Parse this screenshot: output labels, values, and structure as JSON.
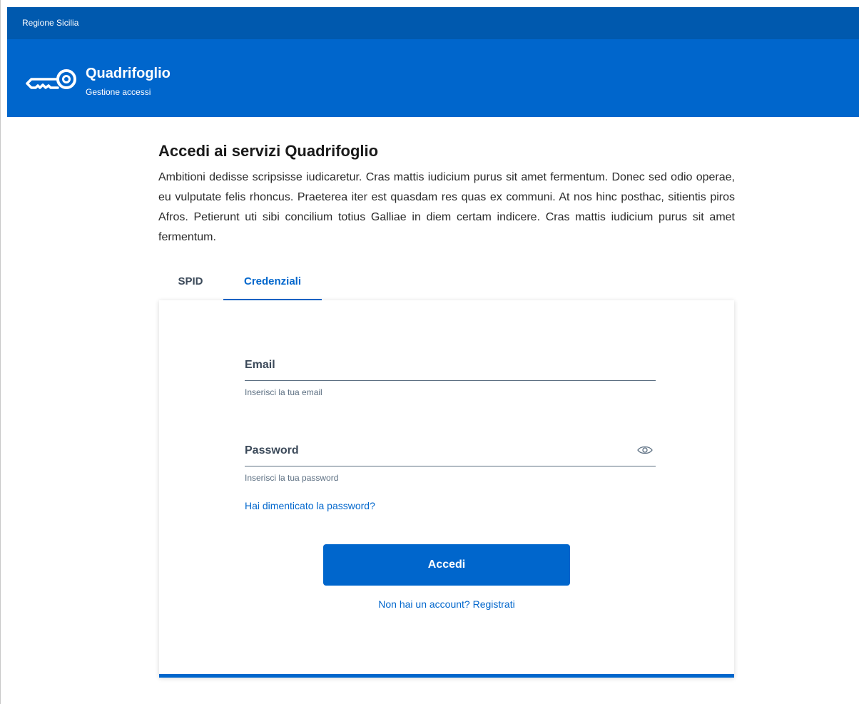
{
  "topbar": {
    "region_label": "Regione Sicilia"
  },
  "header": {
    "icon": "key-icon",
    "title": "Quadrifoglio",
    "subtitle": "Gestione accessi"
  },
  "main": {
    "heading": "Accedi ai servizi Quadrifoglio",
    "intro": "Ambitioni dedisse scripsisse iudicaretur. Cras mattis iudicium purus sit amet fermentum. Donec sed odio operae, eu vulputate felis rhoncus. Praeterea iter est quasdam res quas ex communi. At nos hinc posthac, sitientis piros Afros. Petierunt uti sibi concilium totius Galliae in diem certam indicere. Cras mattis iudicium purus sit amet fermentum."
  },
  "tabs": [
    {
      "label": "SPID",
      "active": false
    },
    {
      "label": "Credenziali",
      "active": true
    }
  ],
  "form": {
    "email": {
      "label": "Email",
      "help": "Inserisci la tua email"
    },
    "password": {
      "label": "Password",
      "help": "Inserisci la tua password",
      "toggle_icon": "eye-icon"
    },
    "forgot_link": "Hai dimenticato la password?",
    "submit_label": "Accedi",
    "register_link": "Non hai un account? Registrati"
  },
  "colors": {
    "topbar": "#0059ae",
    "header": "#0066cc",
    "accent": "#0066cc",
    "text_muted": "#5c6f82"
  }
}
